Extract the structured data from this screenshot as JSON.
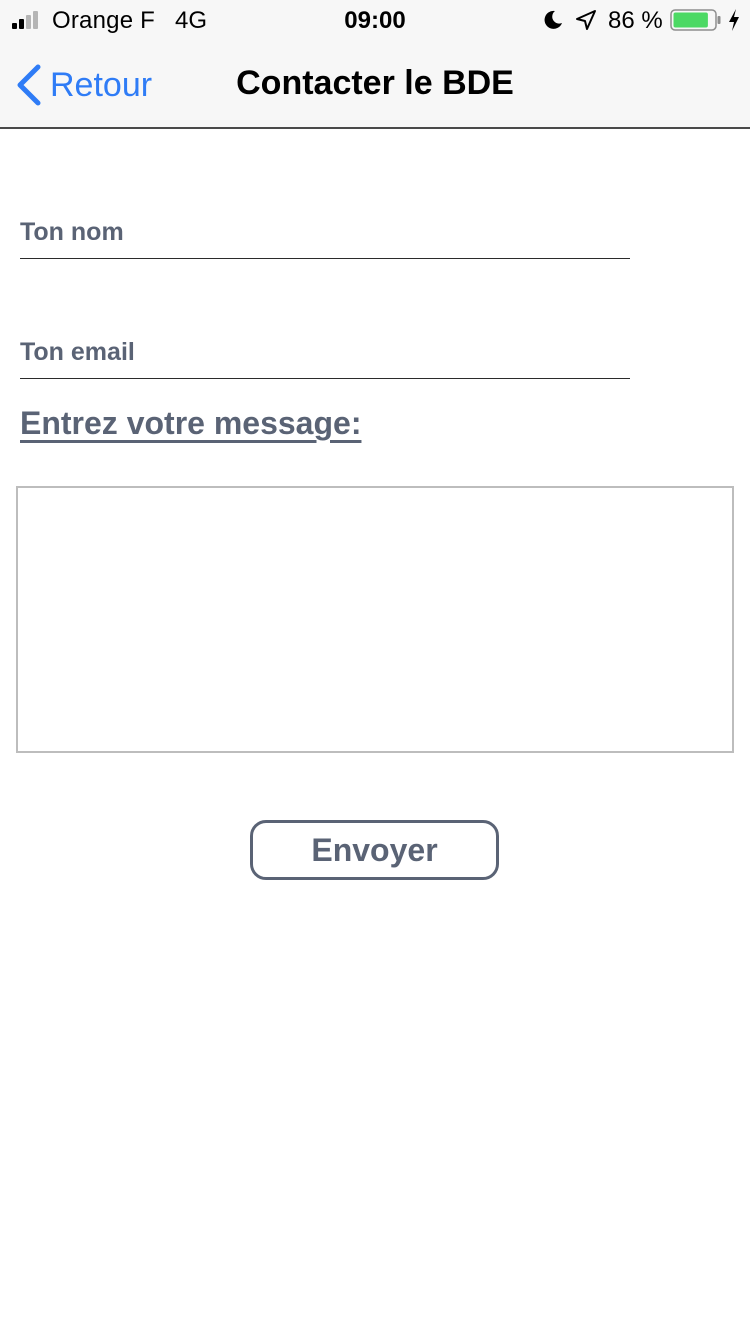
{
  "status_bar": {
    "carrier": "Orange F",
    "network": "4G",
    "time": "09:00",
    "battery_percent": "86 %",
    "signal_bars_filled": 2,
    "signal_bars_total": 4,
    "battery_level": 0.86,
    "icons": [
      "signal-icon",
      "moon-icon",
      "location-arrow-icon",
      "battery-icon",
      "charging-bolt-icon"
    ],
    "battery_color": "#4cd964"
  },
  "nav": {
    "back_label": "Retour",
    "title": "Contacter le BDE",
    "accent_color": "#2f7cf6"
  },
  "form": {
    "name_placeholder": "Ton nom",
    "email_placeholder": "Ton email",
    "message_label": "Entrez votre message:",
    "message_value": "",
    "send_label": "Envoyer",
    "text_color": "#5a6375"
  }
}
